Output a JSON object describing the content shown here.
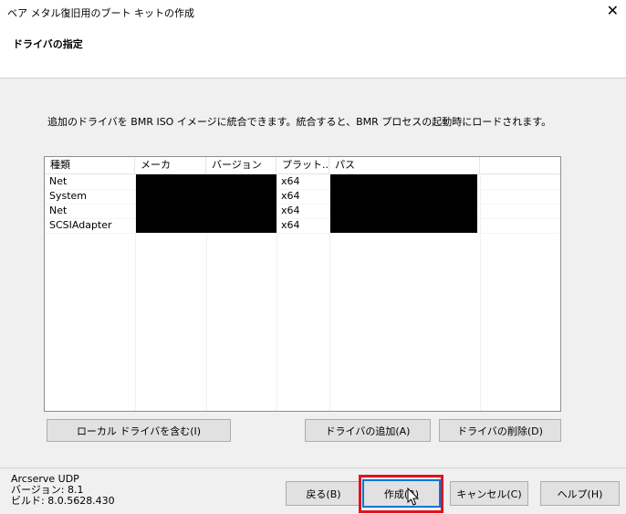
{
  "window": {
    "title": "ベア メタル復旧用のブート キットの作成",
    "close_glyph": "✕"
  },
  "header": {
    "heading": "ドライバの指定"
  },
  "description": "追加のドライバを BMR ISO イメージに統合できます。統合すると、BMR プロセスの起動時にロードされます。",
  "driver_list": {
    "columns": [
      "種類",
      "メーカ",
      "バージョン",
      "プラット...",
      "パス"
    ],
    "rows": [
      {
        "type": "Net",
        "platform": "x64"
      },
      {
        "type": "System",
        "platform": "x64"
      },
      {
        "type": "Net",
        "platform": "x64"
      },
      {
        "type": "SCSIAdapter",
        "platform": "x64"
      }
    ]
  },
  "buttons": {
    "include_local": "ローカル ドライバを含む(I)",
    "add_driver": "ドライバの追加(A)",
    "remove_driver": "ドライバの削除(D)",
    "back": "戻る(B)",
    "create": "作成(R)",
    "cancel": "キャンセル(C)",
    "help": "ヘルプ(H)"
  },
  "product": {
    "name": "Arcserve UDP",
    "version": "バージョン: 8.1",
    "build": "ビルド: 8.0.5628.430"
  },
  "colors": {
    "highlight": "#e0141e",
    "redaction": "#000000",
    "default_button_border": "#0078d7"
  }
}
